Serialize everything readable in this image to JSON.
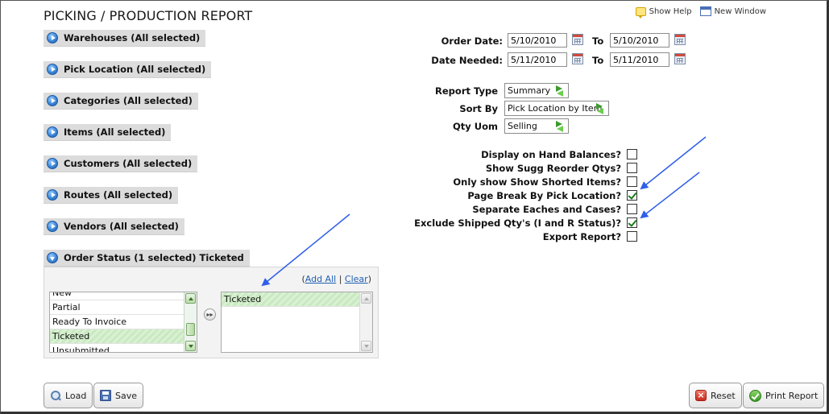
{
  "page": {
    "title": "PICKING / PRODUCTION REPORT"
  },
  "toplinks": {
    "help": "Show Help",
    "new_window": "New Window"
  },
  "sections": [
    {
      "label": "Warehouses (All selected)"
    },
    {
      "label": "Pick Location (All selected)"
    },
    {
      "label": "Categories (All selected)"
    },
    {
      "label": "Items (All selected)"
    },
    {
      "label": "Customers (All selected)"
    },
    {
      "label": "Routes (All selected)"
    },
    {
      "label": "Vendors (All selected)"
    },
    {
      "label": "Order Status (1 selected) Ticketed"
    }
  ],
  "order_status": {
    "add_all": "Add All",
    "separator": "|",
    "clear": "Clear",
    "available": [
      "New",
      "Partial",
      "Ready To Invoice",
      "Ticketed",
      "Unsubmitted"
    ],
    "selected": [
      "Ticketed"
    ]
  },
  "dates": {
    "order_date_label": "Order Date:",
    "order_from": "5/10/2010",
    "to_label": "To",
    "order_to": "5/10/2010",
    "needed_label": "Date Needed:",
    "needed_from": "5/11/2010",
    "needed_to": "5/11/2010"
  },
  "options": {
    "report_type_label": "Report Type",
    "report_type_value": "Summary",
    "sort_by_label": "Sort By",
    "sort_by_value": "Pick Location by Item",
    "qty_uom_label": "Qty Uom",
    "qty_uom_value": "Selling"
  },
  "checkboxes": [
    {
      "label": "Display on Hand Balances?",
      "checked": false
    },
    {
      "label": "Show Sugg Reorder Qtys?",
      "checked": false
    },
    {
      "label": "Only show Show Shorted Items?",
      "checked": false
    },
    {
      "label": "Page Break By Pick Location?",
      "checked": true
    },
    {
      "label": "Separate Eaches and Cases?",
      "checked": false
    },
    {
      "label": "Exclude Shipped Qty's (I and R Status)?",
      "checked": true
    },
    {
      "label": "Export Report?",
      "checked": false
    }
  ],
  "buttons": {
    "load": "Load",
    "save": "Save",
    "reset": "Reset",
    "print": "Print Report"
  },
  "colors": {
    "annotation_arrow": "#2f5fe8",
    "selection_green": "#d9f1d3",
    "section_bg": "#dcdcdc"
  }
}
